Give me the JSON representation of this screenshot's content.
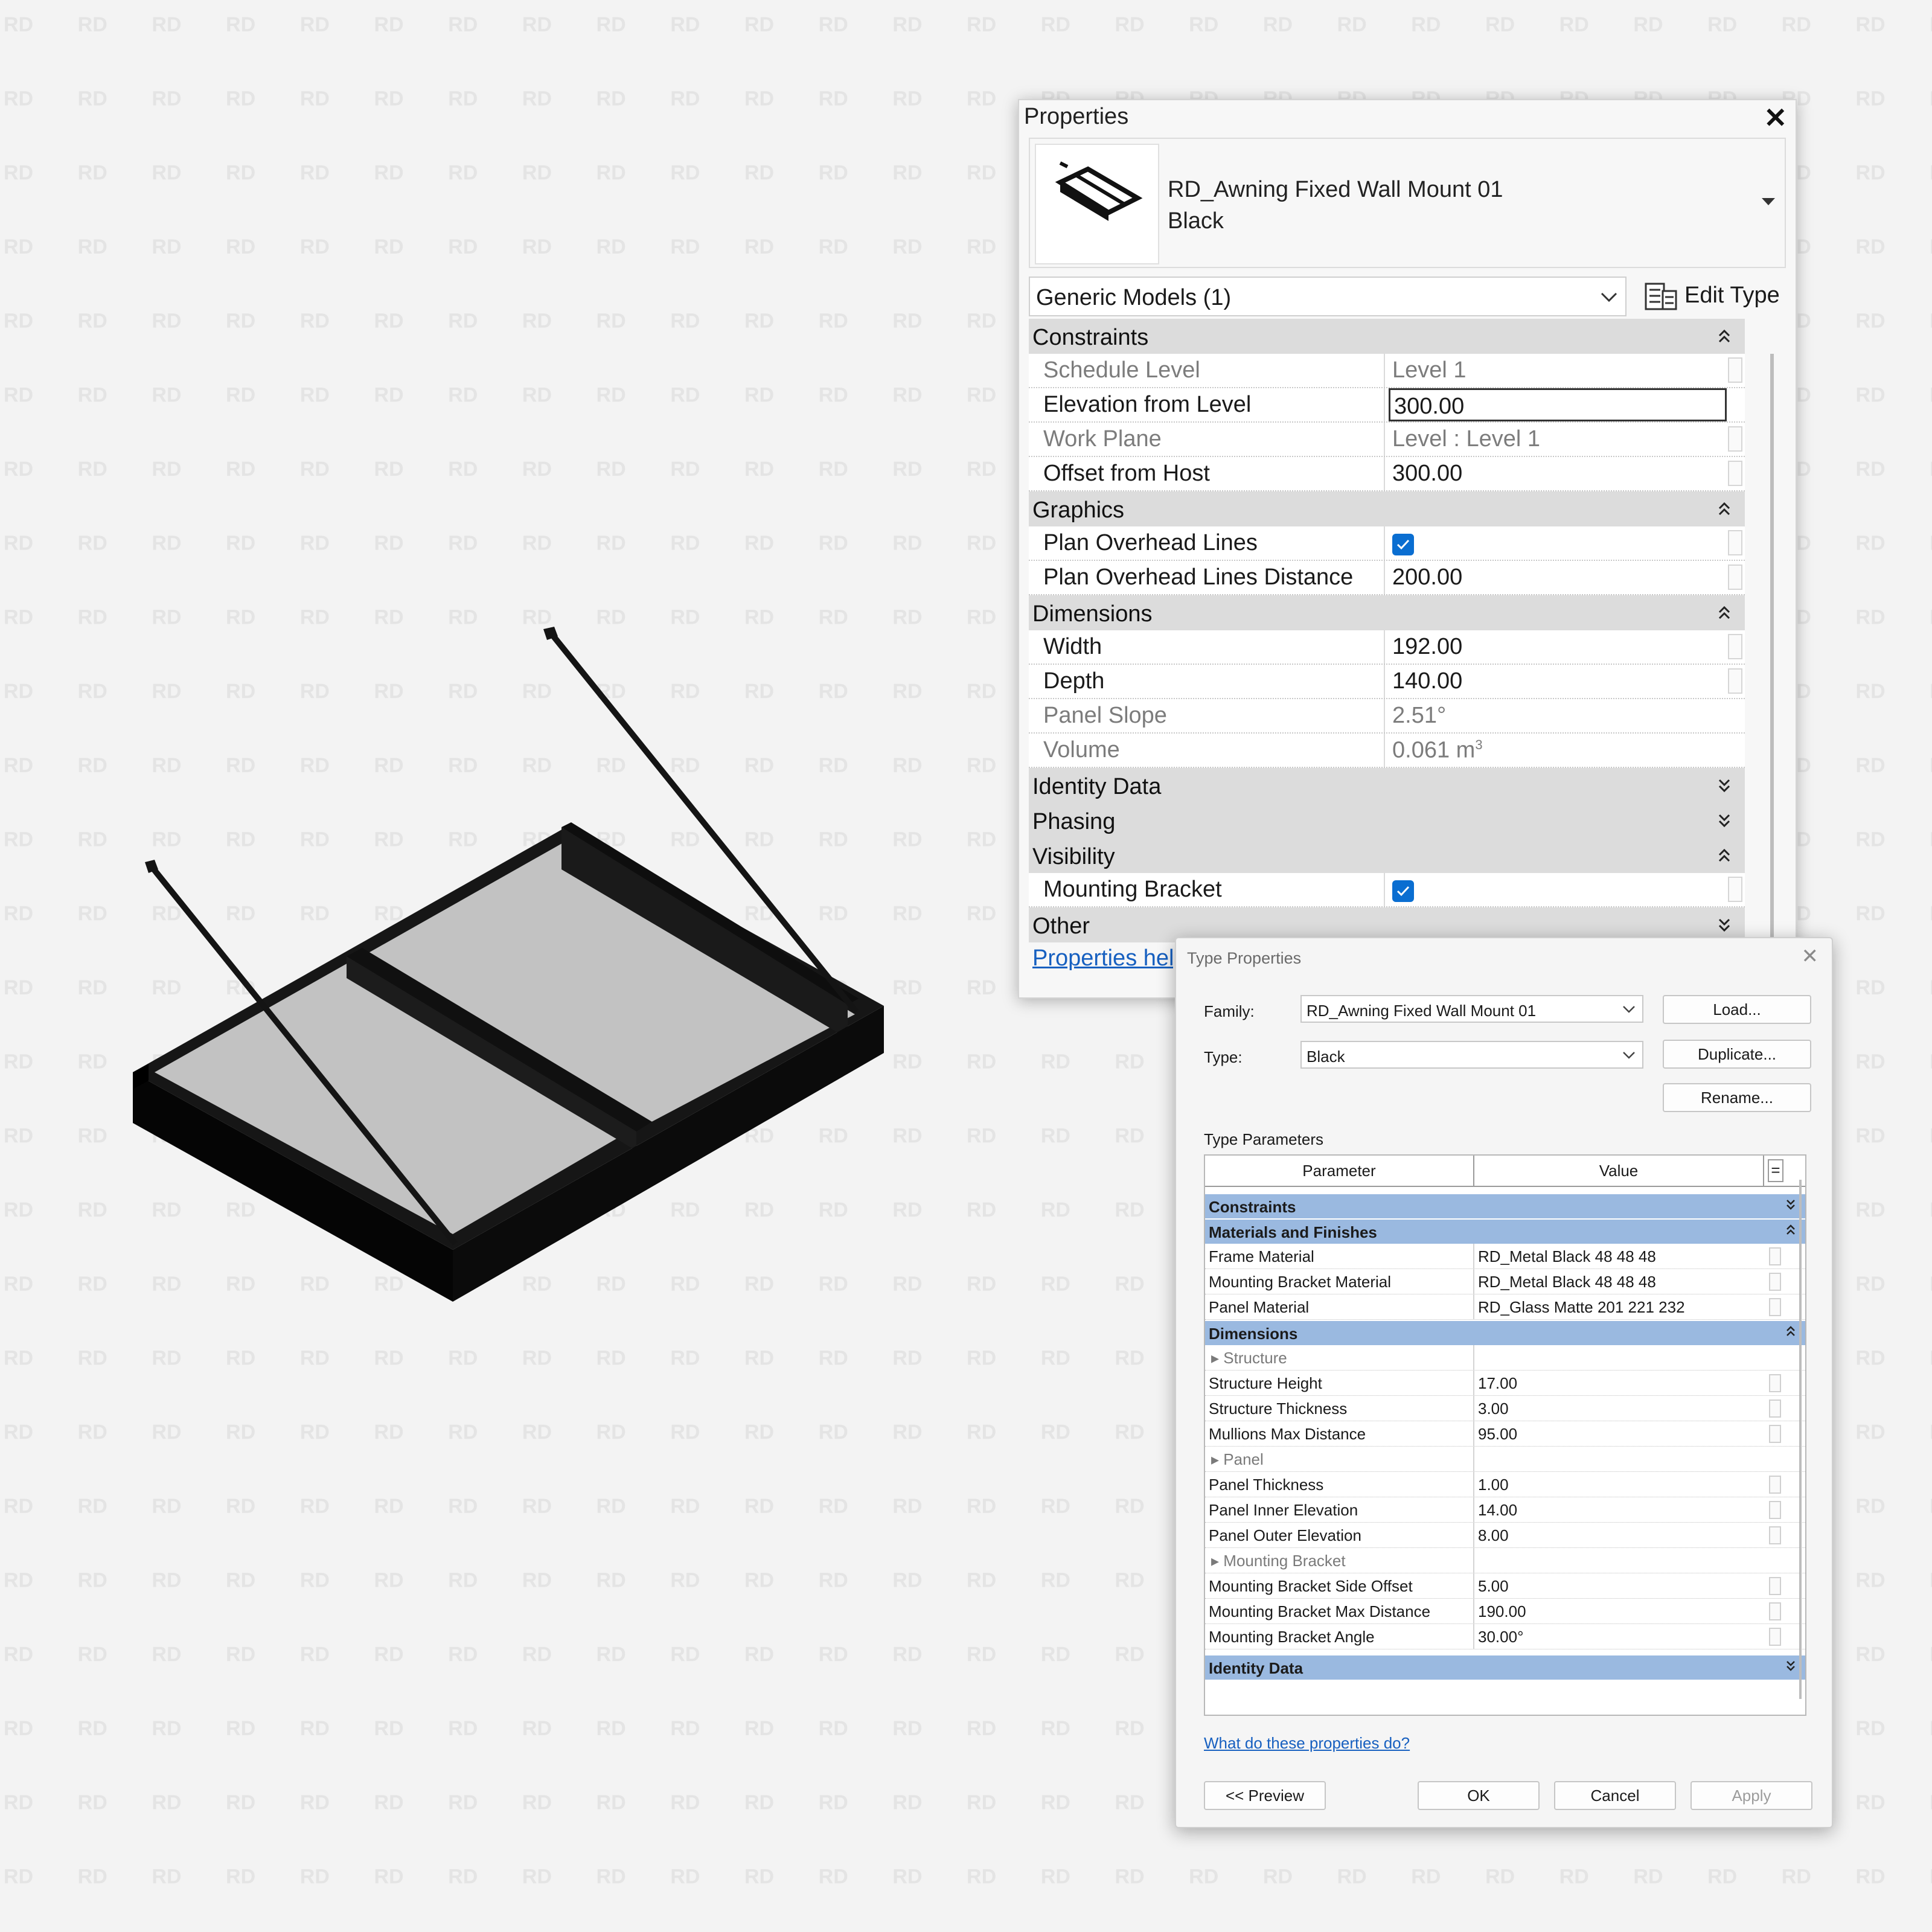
{
  "watermark_text": "RD",
  "properties": {
    "title": "Properties",
    "type_name_line1": "RD_Awning Fixed Wall Mount 01",
    "type_name_line2": "Black",
    "category": "Generic Models (1)",
    "edit_type_label": "Edit Type",
    "help_link": "Properties help",
    "groups": {
      "constraints": "Constraints",
      "graphics": "Graphics",
      "dimensions": "Dimensions",
      "identity": "Identity Data",
      "phasing": "Phasing",
      "visibility": "Visibility",
      "other": "Other"
    },
    "rows": {
      "schedule_level": {
        "name": "Schedule Level",
        "value": "Level 1"
      },
      "elevation": {
        "name": "Elevation from Level",
        "value": "300.00"
      },
      "work_plane": {
        "name": "Work Plane",
        "value": "Level : Level 1"
      },
      "offset_host": {
        "name": "Offset from Host",
        "value": "300.00"
      },
      "plan_overhead": {
        "name": "Plan Overhead Lines",
        "checked": true
      },
      "plan_overhead_dist": {
        "name": "Plan Overhead Lines Distance",
        "value": "200.00"
      },
      "width": {
        "name": "Width",
        "value": "192.00"
      },
      "depth": {
        "name": "Depth",
        "value": "140.00"
      },
      "panel_slope": {
        "name": "Panel Slope",
        "value": "2.51°"
      },
      "volume": {
        "name": "Volume",
        "value": "0.061 m",
        "unit_sup": "3"
      },
      "mounting_bracket": {
        "name": "Mounting Bracket",
        "checked": true
      }
    }
  },
  "type_properties": {
    "title": "Type Properties",
    "family_label": "Family:",
    "family_value": "RD_Awning Fixed Wall Mount 01",
    "type_label": "Type:",
    "type_value": "Black",
    "load_btn": "Load...",
    "duplicate_btn": "Duplicate...",
    "rename_btn": "Rename...",
    "type_params_label": "Type Parameters",
    "col_param": "Parameter",
    "col_value": "Value",
    "col_eq": "=",
    "groups": {
      "constraints": "Constraints",
      "materials": "Materials and Finishes",
      "dimensions": "Dimensions",
      "identity": "Identity Data"
    },
    "materials": [
      {
        "name": "Frame Material",
        "value": "RD_Metal Black 48 48 48"
      },
      {
        "name": "Mounting Bracket Material",
        "value": "RD_Metal Black 48 48 48"
      },
      {
        "name": "Panel Material",
        "value": "RD_Glass Matte 201 221 232"
      }
    ],
    "dims": {
      "structure_header": "Structure",
      "structure_height": {
        "name": "Structure Height",
        "value": "17.00"
      },
      "structure_thickness": {
        "name": "Structure Thickness",
        "value": "3.00"
      },
      "mullions": {
        "name": "Mullions Max Distance",
        "value": "95.00"
      },
      "panel_header": "Panel",
      "panel_thickness": {
        "name": "Panel Thickness",
        "value": "1.00"
      },
      "panel_inner": {
        "name": "Panel Inner Elevation",
        "value": "14.00"
      },
      "panel_outer": {
        "name": "Panel Outer Elevation",
        "value": "8.00"
      },
      "bracket_header": "Mounting Bracket",
      "bracket_side": {
        "name": "Mounting Bracket Side Offset",
        "value": "5.00"
      },
      "bracket_max": {
        "name": "Mounting Bracket Max Distance",
        "value": "190.00"
      },
      "bracket_angle": {
        "name": "Mounting Bracket Angle",
        "value": "30.00°"
      }
    },
    "help_link": "What do these properties do?",
    "preview_btn": "<< Preview",
    "ok_btn": "OK",
    "cancel_btn": "Cancel",
    "apply_btn": "Apply"
  },
  "colors": {
    "frame": "#111111",
    "glass": "#c2c2c2",
    "checkbox": "#0a6ed1",
    "group_blue": "#9ab9e0",
    "link": "#1760c0"
  }
}
